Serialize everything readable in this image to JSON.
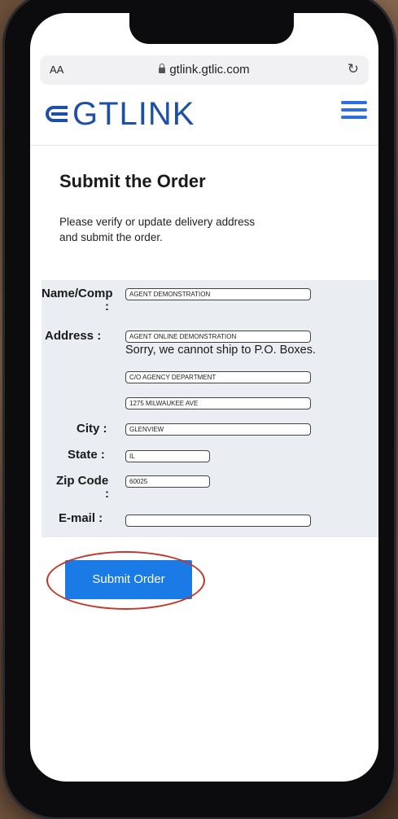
{
  "browser": {
    "text_size_label": "AA",
    "url": "gtlink.gtlic.com"
  },
  "header": {
    "logo_text": "GTLINK",
    "brand_color": "#1d4ea8",
    "menu_color": "#2f6ee0"
  },
  "page": {
    "title": "Submit the Order",
    "instructions": "Please verify or update delivery address and submit the order."
  },
  "form": {
    "name_label": "Name/Comp",
    "name_value": "AGENT DEMONSTRATION",
    "address_label": "Address :",
    "address_line1": "AGENT ONLINE DEMONSTRATION",
    "po_box_note": "Sorry, we cannot ship to P.O. Boxes.",
    "address_line2": "C/O AGENCY DEPARTMENT",
    "address_line3": "1275 MILWAUKEE AVE",
    "city_label": "City :",
    "city_value": "GLENVIEW",
    "state_label": "State :",
    "state_value": "IL",
    "zip_label": "Zip Code",
    "zip_value": "60025",
    "email_label": "E-mail :",
    "email_value": "",
    "colon": ":"
  },
  "actions": {
    "submit_label": "Submit Order",
    "button_color": "#1a7be6",
    "highlight_color": "#c0392b"
  }
}
